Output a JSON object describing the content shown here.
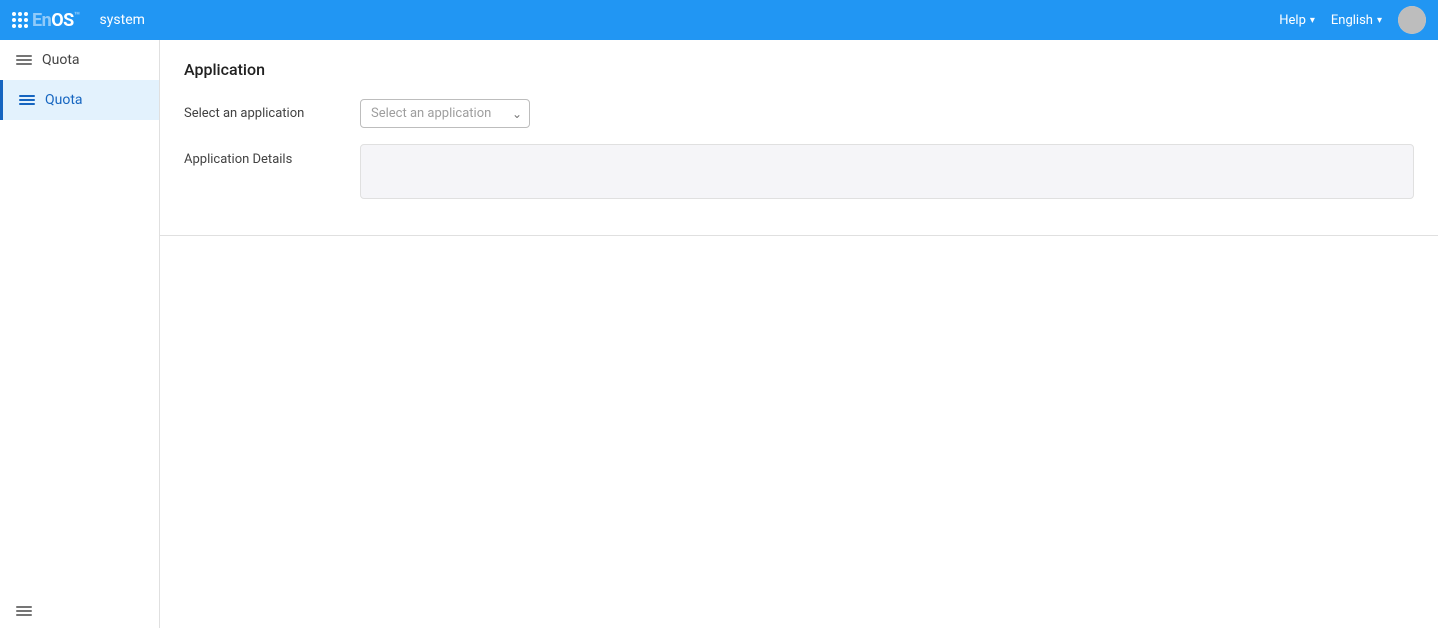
{
  "navbar": {
    "logo_text": "EnOS",
    "logo_tm": "™",
    "title": "system",
    "help_label": "Help",
    "language_label": "English"
  },
  "sidebar": {
    "items": [
      {
        "id": "quota-top",
        "label": "Quota",
        "active": false
      },
      {
        "id": "quota-main",
        "label": "Quota",
        "active": true
      }
    ],
    "bottom_icon_name": "menu-bottom-icon"
  },
  "content": {
    "section_title": "Application",
    "select_label": "Select an application",
    "select_placeholder": "Select an application",
    "details_label": "Application Details"
  }
}
